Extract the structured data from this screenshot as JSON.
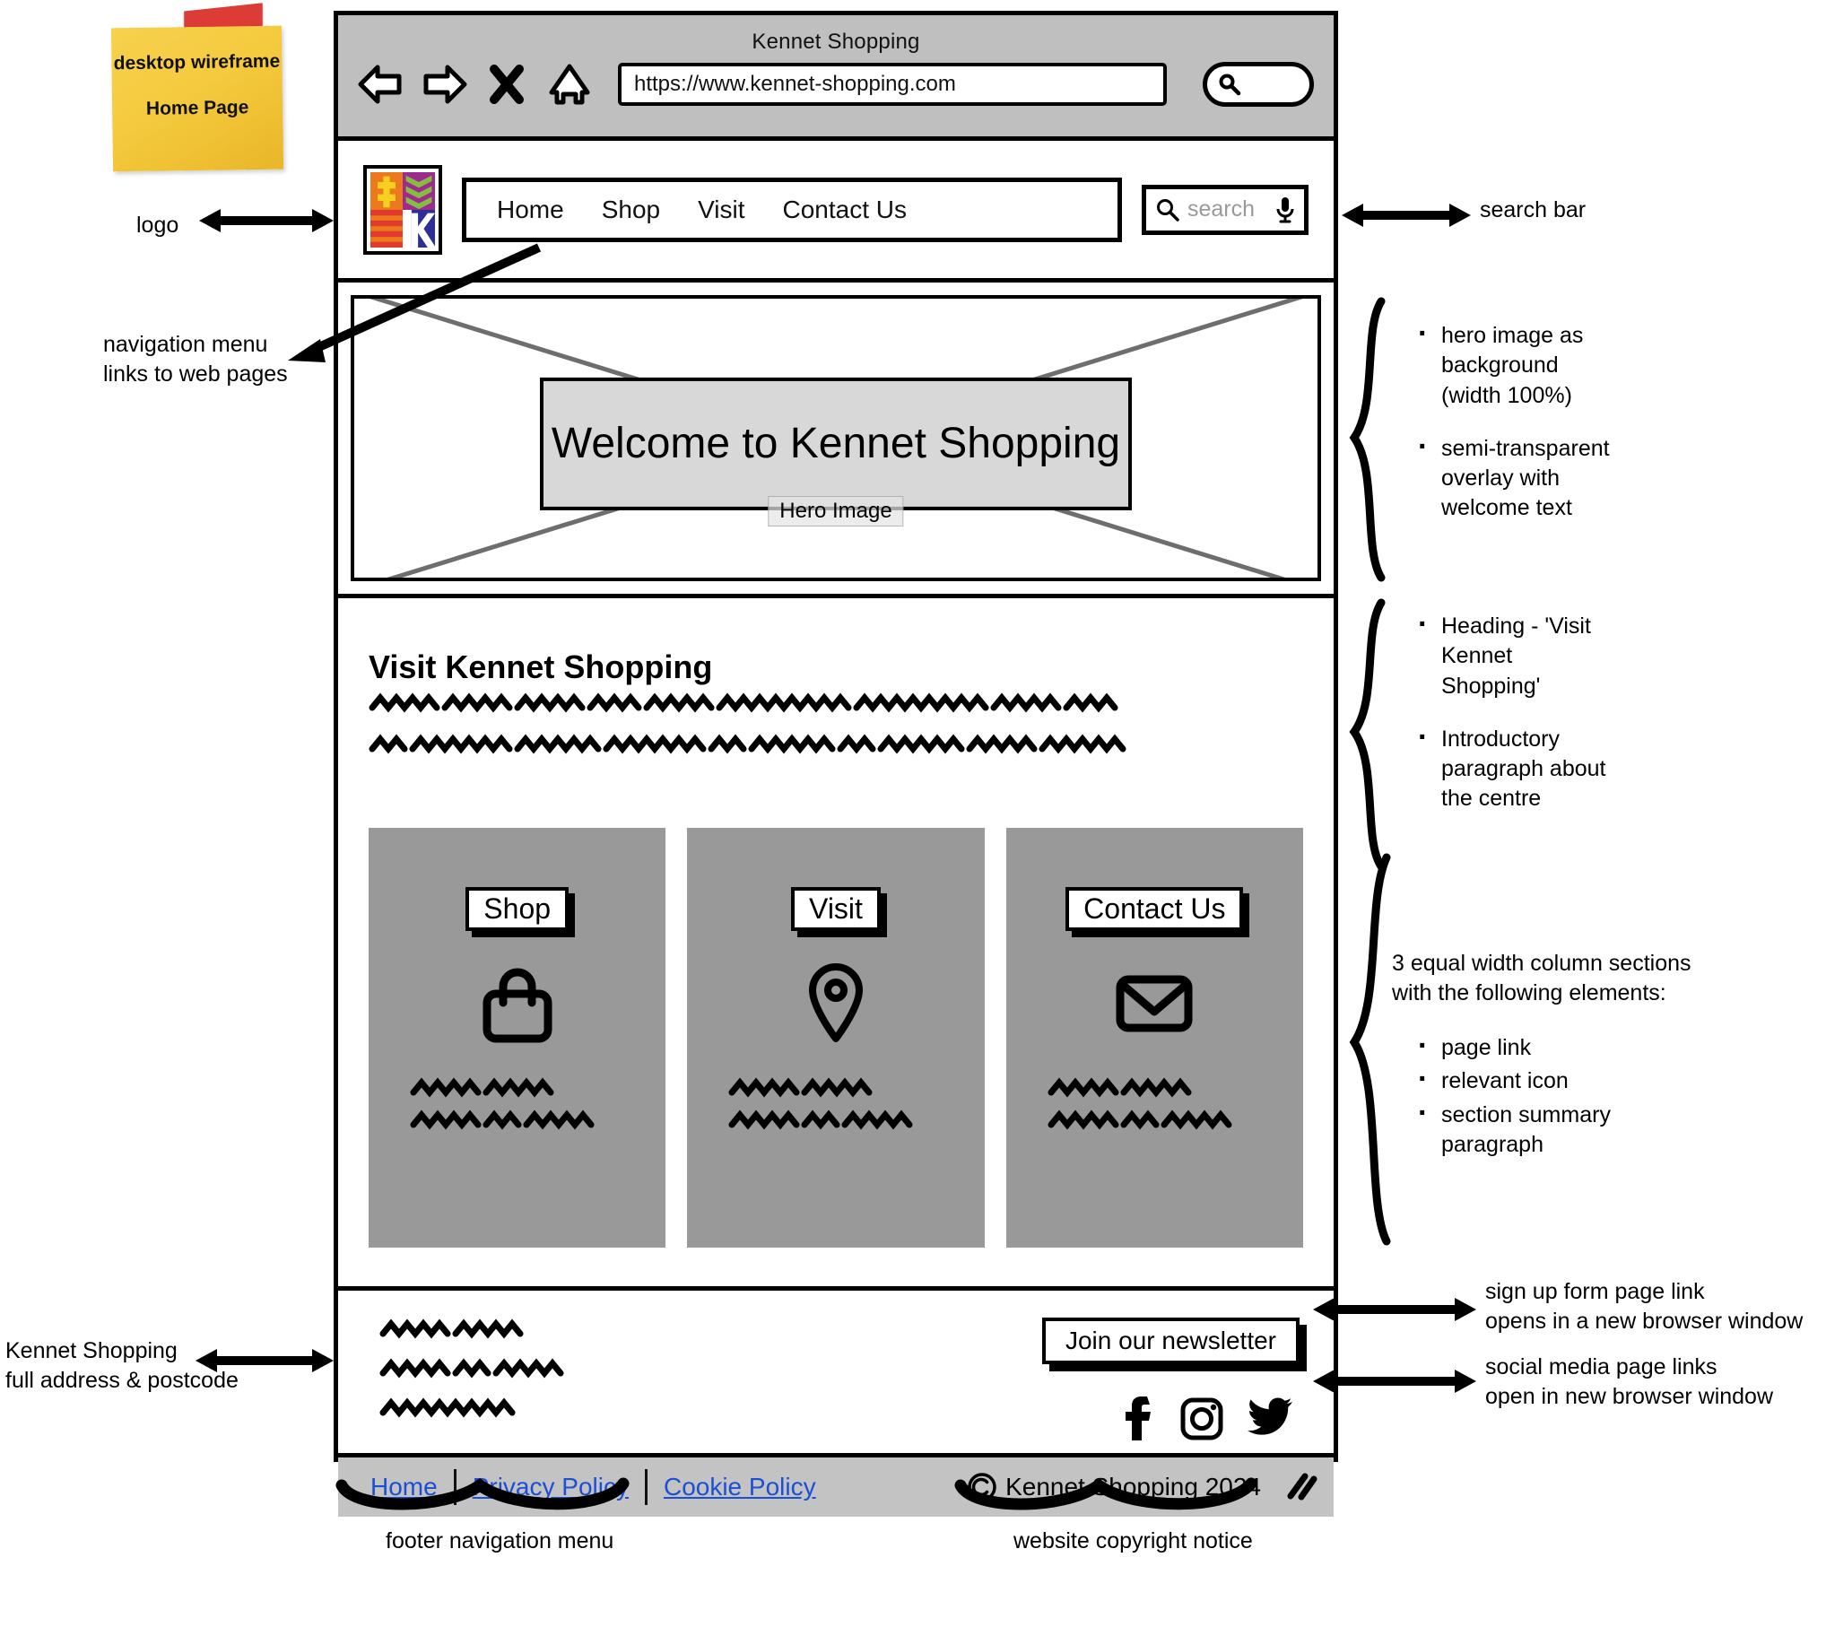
{
  "sticky_note": {
    "line1": "desktop wireframe",
    "line2": "Home Page"
  },
  "browser": {
    "window_title": "Kennet Shopping",
    "url": "https://www.kennet-shopping.com",
    "controls": [
      "back-icon",
      "forward-icon",
      "close-icon",
      "home-icon"
    ],
    "chrome_search_icon": "magnifier-icon"
  },
  "site_header": {
    "logo_alt": "Kennet Shopping logo",
    "nav_links": [
      "Home",
      "Shop",
      "Visit",
      "Contact Us"
    ],
    "search": {
      "placeholder": "search",
      "search_icon": "magnifier-icon",
      "mic_icon": "microphone-icon"
    }
  },
  "hero": {
    "tag": "Hero Image",
    "welcome_text": "Welcome to Kennet Shopping"
  },
  "main": {
    "heading": "Visit Kennet Shopping",
    "intro_paragraph_placeholder": "squiggle-placeholder-2-lines",
    "columns": [
      {
        "label": "Shop",
        "icon": "shopping-bag-icon",
        "summary_placeholder": "squiggle-placeholder-2-lines"
      },
      {
        "label": "Visit",
        "icon": "map-pin-icon",
        "summary_placeholder": "squiggle-placeholder-2-lines"
      },
      {
        "label": "Contact Us",
        "icon": "envelope-icon",
        "summary_placeholder": "squiggle-placeholder-2-lines"
      }
    ]
  },
  "footer": {
    "address_placeholder": "squiggle-placeholder-3-lines",
    "newsletter_button": "Join our newsletter",
    "social_icons": [
      "facebook-icon",
      "instagram-icon",
      "twitter-icon"
    ],
    "nav_links": [
      "Home",
      "Privacy Policy",
      "Cookie Policy"
    ],
    "copyright": "Kennet Shopping 2024",
    "copyright_symbol": "©",
    "resize_grip": "resize-grip-icon"
  },
  "annotations": {
    "logo": "logo",
    "nav_menu": "navigation menu\nlinks to web pages",
    "search_bar": "search bar",
    "hero_notes": [
      "hero image as background (width 100%)",
      "semi-transparent overlay with welcome text"
    ],
    "hero_note_lines": [
      [
        "hero image as",
        "background",
        "(width 100%)"
      ],
      [
        "semi-transparent",
        "overlay with",
        "welcome text"
      ]
    ],
    "intro_note_lines": [
      [
        "Heading - 'Visit",
        "Kennet",
        "Shopping'"
      ],
      [
        "Introductory",
        "paragraph about",
        "the centre"
      ]
    ],
    "columns_note_heading": [
      "3 equal width column sections",
      "with the following elements:"
    ],
    "columns_note_bullets": [
      "page link",
      "relevant icon",
      [
        "section summary",
        "paragraph"
      ]
    ],
    "address_note": [
      "Kennet Shopping",
      "full address & postcode"
    ],
    "newsletter_note": [
      "sign up form page link",
      "opens in a new browser window"
    ],
    "social_note": [
      "social media page links",
      "open in new browser window"
    ],
    "footer_nav_note": "footer navigation menu",
    "copyright_note": "website copyright notice"
  },
  "colors": {
    "chrome_grey": "#bfbfbf",
    "column_grey": "#999999",
    "overlay_grey": "#d8d8d8",
    "footer_bar_grey": "#c3c3c3",
    "link_blue": "#1a4fd6",
    "sticky_yellow": "#f5ca3e",
    "tape_red": "#dd3b36"
  }
}
